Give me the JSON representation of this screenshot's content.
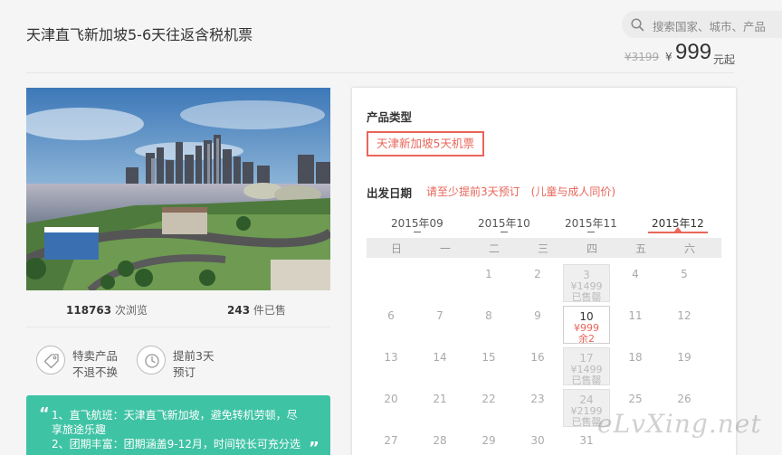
{
  "header": {
    "title": "天津直飞新加坡5-6天往返含税机票",
    "search_placeholder": "搜索国家、城市、产品",
    "old_price": "¥3199",
    "currency": "¥",
    "price": "999",
    "price_suffix": "元起"
  },
  "stats": {
    "views_num": "118763",
    "views_label": "次浏览",
    "sold_num": "243",
    "sold_label": "件已售"
  },
  "features": [
    {
      "icon": "tag-icon",
      "line1": "特卖产品",
      "line2": "不退不换"
    },
    {
      "icon": "clock-icon",
      "line1": "提前3天",
      "line2": "预订"
    }
  ],
  "highlights": {
    "open_quote": "“",
    "close_quote": "”",
    "line1": "1、直飞航班：天津直飞新加坡，避免转机劳顿，尽享旅途乐趣",
    "line2": "2、团期丰富：团期涵盖9-12月，时间较长可充分选"
  },
  "booking": {
    "product_type_label": "产品类型",
    "product_type_option": "天津新加坡5天机票",
    "date_label": "出发日期",
    "date_tip": "请至少提前3天预订　(儿童与成人同价)",
    "months": [
      "2015年09",
      "2015年10",
      "2015年11",
      "2015年12"
    ],
    "active_month_index": 3,
    "weekdays": [
      "日",
      "一",
      "二",
      "三",
      "四",
      "五",
      "六"
    ],
    "calendar_rows": [
      [
        {
          "d": ""
        },
        {
          "d": ""
        },
        {
          "d": "1"
        },
        {
          "d": "2"
        },
        {
          "d": "3",
          "p": "¥1499",
          "s": "已售罄",
          "st": "past"
        },
        {
          "d": "4"
        },
        {
          "d": "5"
        }
      ],
      [
        {
          "d": "6"
        },
        {
          "d": "7"
        },
        {
          "d": "8"
        },
        {
          "d": "9"
        },
        {
          "d": "10",
          "p": "¥999",
          "s": "余2",
          "st": "avail"
        },
        {
          "d": "11"
        },
        {
          "d": "12"
        }
      ],
      [
        {
          "d": "13"
        },
        {
          "d": "14"
        },
        {
          "d": "15"
        },
        {
          "d": "16"
        },
        {
          "d": "17",
          "p": "¥1499",
          "s": "已售罄",
          "st": "past"
        },
        {
          "d": "18"
        },
        {
          "d": "19"
        }
      ],
      [
        {
          "d": "20"
        },
        {
          "d": "21"
        },
        {
          "d": "22"
        },
        {
          "d": "23"
        },
        {
          "d": "24",
          "p": "¥2199",
          "s": "已售罄",
          "st": "past"
        },
        {
          "d": "25"
        },
        {
          "d": "26"
        }
      ],
      [
        {
          "d": "27"
        },
        {
          "d": "28"
        },
        {
          "d": "29"
        },
        {
          "d": "30"
        },
        {
          "d": "31"
        },
        {
          "d": ""
        },
        {
          "d": ""
        }
      ]
    ]
  },
  "watermark": "eLvXing.net",
  "colors": {
    "accent": "#e8665a",
    "green": "#3fc3a5"
  }
}
